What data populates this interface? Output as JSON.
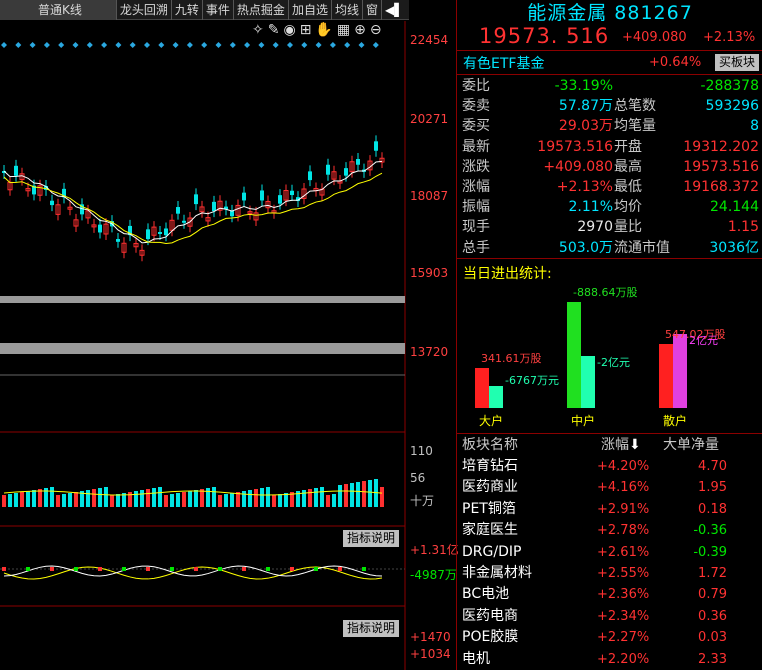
{
  "toolbar": {
    "items": [
      "普通K线",
      "龙头回溯",
      "九转",
      "事件",
      "热点掘金",
      "加自选",
      "均线",
      "窗"
    ],
    "collapse_icon": "collapse-icon"
  },
  "chart": {
    "price_axis": [
      "22454",
      "20271",
      "18087",
      "15903",
      "13720"
    ],
    "volume_axis": [
      "110",
      "56",
      "十万"
    ],
    "indicator_axis": [
      "+1.31亿",
      "-4987万"
    ],
    "indicator2_axis": [
      "+1470",
      "+1034"
    ],
    "indicator_note_label": "指标说明",
    "tools": [
      "magic-icon",
      "pen-icon",
      "eye-icon",
      "gift-icon",
      "hand-icon",
      "grid-icon",
      "plus-circle-icon",
      "minus-circle-icon"
    ]
  },
  "stock": {
    "name": "能源金属",
    "code": "881267",
    "price": "19573. 516",
    "change": "+409.080",
    "pct": "+2.13%",
    "etf_name": "有色ETF基金",
    "etf_pct": "+0.64%",
    "buy_board_label": "买板块"
  },
  "quote_rows": [
    {
      "l1": "委比",
      "v1": "-33.19%",
      "c1": "grn",
      "l2": "",
      "v2": "-288378",
      "c2": "grn"
    },
    {
      "l1": "委卖",
      "v1": "57.87万",
      "c1": "cyan",
      "l2": "总笔数",
      "v2": "593296",
      "c2": "cyan"
    },
    {
      "l1": "委买",
      "v1": "29.03万",
      "c1": "red",
      "l2": "均笔量",
      "v2": "8",
      "c2": "cyan"
    },
    {
      "l1": "最新",
      "v1": "19573.516",
      "c1": "red",
      "l2": "开盘",
      "v2": "19312.202",
      "c2": "red"
    },
    {
      "l1": "涨跌",
      "v1": "+409.080",
      "c1": "red",
      "l2": "最高",
      "v2": "19573.516",
      "c2": "red"
    },
    {
      "l1": "涨幅",
      "v1": "+2.13%",
      "c1": "red",
      "l2": "最低",
      "v2": "19168.372",
      "c2": "red"
    },
    {
      "l1": "振幅",
      "v1": "2.11%",
      "c1": "cyan",
      "l2": "均价",
      "v2": "24.144",
      "c2": "grn"
    },
    {
      "l1": "现手",
      "v1": "2970",
      "c1": "wht",
      "l2": "量比",
      "v2": "1.15",
      "c2": "red"
    },
    {
      "l1": "总手",
      "v1": "503.0万",
      "c1": "cyan",
      "l2": "流通市值",
      "v2": "3036亿",
      "c2": "cyan"
    }
  ],
  "flow": {
    "title": "当日进出统计:",
    "groups": [
      {
        "name": "大户",
        "in_label": "341.61万股",
        "out_label": "-6767万元",
        "in_color": "#ff2020",
        "out_color": "#20ffb0",
        "in_h": 40,
        "out_h": 22
      },
      {
        "name": "中户",
        "in_label": "-888.64万股",
        "out_label": "-2亿元",
        "in_color": "#20e020",
        "out_color": "#20ffb0",
        "in_h": 106,
        "out_h": 52
      },
      {
        "name": "散户",
        "in_label": "547.02万股",
        "out_label": "2亿元",
        "in_color": "#ff2020",
        "out_color": "#e040e0",
        "in_h": 64,
        "out_h": 74
      }
    ]
  },
  "sector_table": {
    "headers": [
      "板块名称",
      "涨幅",
      "大单净量"
    ],
    "rows": [
      {
        "name": "培育钻石",
        "pct": "+4.20%",
        "net": "4.70",
        "nc": "red"
      },
      {
        "name": "医药商业",
        "pct": "+4.16%",
        "net": "1.95",
        "nc": "red"
      },
      {
        "name": "PET铜箔",
        "pct": "+2.91%",
        "net": "0.18",
        "nc": "red"
      },
      {
        "name": "家庭医生",
        "pct": "+2.78%",
        "net": "-0.36",
        "nc": "grn"
      },
      {
        "name": "DRG/DIP",
        "pct": "+2.61%",
        "net": "-0.39",
        "nc": "grn"
      },
      {
        "name": "非金属材料",
        "pct": "+2.55%",
        "net": "1.72",
        "nc": "red"
      },
      {
        "name": "BC电池",
        "pct": "+2.36%",
        "net": "0.79",
        "nc": "red"
      },
      {
        "name": "医药电商",
        "pct": "+2.34%",
        "net": "0.36",
        "nc": "red"
      },
      {
        "name": "POE胶膜",
        "pct": "+2.27%",
        "net": "0.03",
        "nc": "red"
      },
      {
        "name": "电机",
        "pct": "+2.20%",
        "net": "2.33",
        "nc": "red"
      }
    ]
  }
}
